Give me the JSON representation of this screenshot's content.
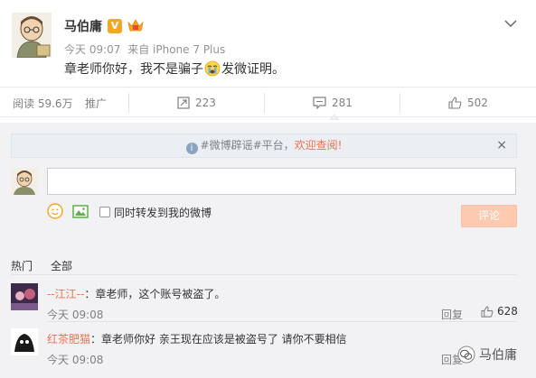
{
  "post": {
    "author": "马伯庸",
    "verified_badge": "V",
    "time": "今天 09:07",
    "source": "来自 iPhone 7 Plus",
    "text_before": "章老师你好，我不是骗子",
    "text_after": "发微证明。"
  },
  "actions": {
    "reads": "阅读 59.6万",
    "promote": "推广",
    "repost_count": "223",
    "comment_count": "281",
    "like_count": "502"
  },
  "comments_panel": {
    "notice_prefix": "#微博辟谣#平台，",
    "notice_link": "欢迎查阅!",
    "notice_close": "×",
    "input_placeholder": "",
    "repost_checkbox_label": "同时转发到我的微博",
    "submit_label": "评论",
    "tabs": [
      "热门",
      "全部"
    ]
  },
  "comments": [
    {
      "user": "--江江--",
      "text": "：章老师，这个账号被盗了。",
      "time": "今天 09:08",
      "reply": "回复",
      "likes": "628"
    },
    {
      "user": "红茶肥猫",
      "text": "：章老师你好  亲王现在应该是被盗号了  请你不要相信",
      "time": "今天 09:08",
      "reply": "回复",
      "likes": ""
    }
  ],
  "watermark": {
    "text": "马伯庸"
  },
  "colors": {
    "accent_orange": "#eb7350",
    "submit_disabled": "#fdc9b0",
    "panel_bg": "#f2f2f5",
    "notice_bg": "#ebeff4"
  }
}
